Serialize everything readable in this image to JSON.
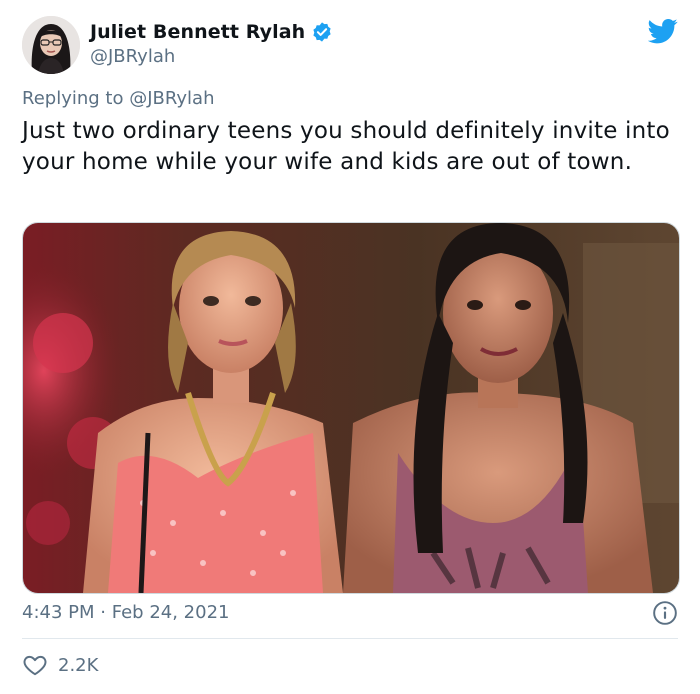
{
  "tweet": {
    "author": {
      "display_name": "Juliet Bennett Rylah",
      "handle": "@JBRylah",
      "verified": true
    },
    "reply": {
      "prefix": "Replying to",
      "mention": "@JBRylah"
    },
    "text": "Just two ordinary teens you should definitely invite into your home while your wife and kids are out of town.",
    "time": "4:43 PM",
    "separator": "·",
    "date": "Feb 24, 2021",
    "likes": "2.2K"
  },
  "icons": {
    "brand": "twitter-bird-icon",
    "verified": "verified-badge-icon",
    "info": "info-icon",
    "like": "heart-icon"
  },
  "colors": {
    "brand": "#1da1f2",
    "secondary_text": "#5b7083",
    "primary_text": "#0f1419"
  }
}
